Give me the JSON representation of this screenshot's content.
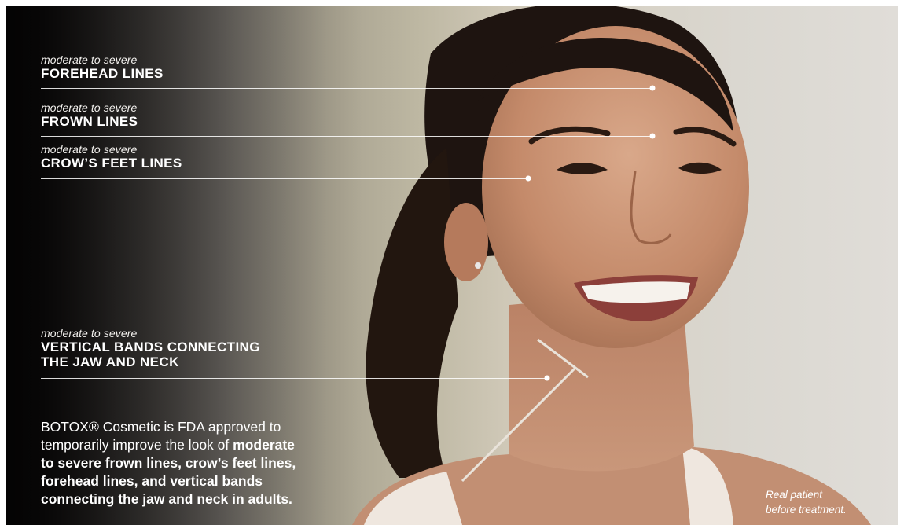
{
  "labels": [
    {
      "id": "forehead",
      "qualifier": "moderate to severe",
      "title": "FOREHEAD LINES"
    },
    {
      "id": "frown",
      "qualifier": "moderate to severe",
      "title": "FROWN LINES"
    },
    {
      "id": "crows-feet",
      "qualifier": "moderate to severe",
      "title": "CROW’S FEET LINES"
    },
    {
      "id": "neck",
      "qualifier": "moderate to severe",
      "title_line1": "VERTICAL BANDS CONNECTING",
      "title_line2": "THE JAW AND NECK"
    }
  ],
  "disclaimer": {
    "line1": "BOTOX® Cosmetic is FDA approved to",
    "line2_plain": "temporarily improve the look of ",
    "line2_bold": "moderate",
    "line3_bold": "to severe frown lines, crow’s feet lines,",
    "line4_bold": "forehead lines, and vertical bands",
    "line5_bold": "connecting the jaw and neck in adults."
  },
  "patient_note": {
    "line1": "Real patient",
    "line2": "before treatment."
  }
}
